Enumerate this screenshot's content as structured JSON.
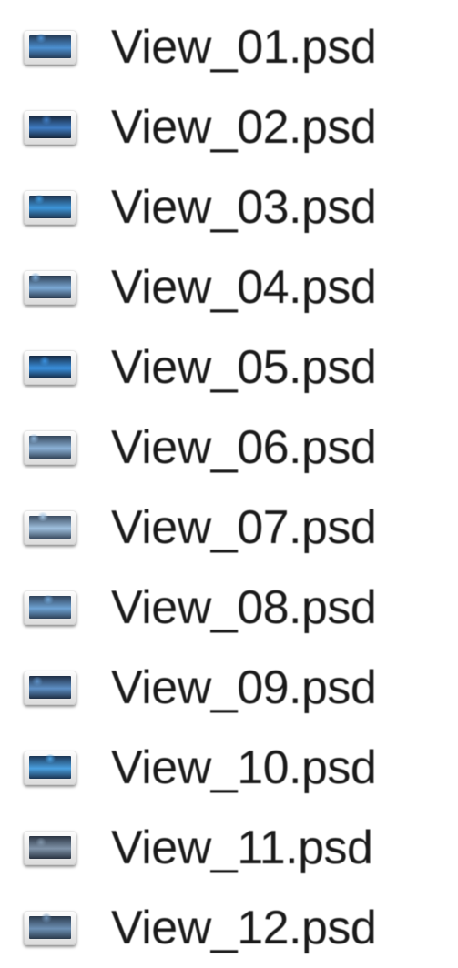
{
  "files": [
    {
      "name": "View_01.psd",
      "icon": "psd-file-icon",
      "thumb_color": "#253c57",
      "accent": "#4c8fd0"
    },
    {
      "name": "View_02.psd",
      "icon": "psd-file-icon",
      "thumb_color": "#15253a",
      "accent": "#3f7cc2"
    },
    {
      "name": "View_03.psd",
      "icon": "psd-file-icon",
      "thumb_color": "#1e3550",
      "accent": "#3d95d8"
    },
    {
      "name": "View_04.psd",
      "icon": "psd-file-icon",
      "thumb_color": "#2b3c50",
      "accent": "#7aa8d4"
    },
    {
      "name": "View_05.psd",
      "icon": "psd-file-icon",
      "thumb_color": "#162a44",
      "accent": "#3a90dd"
    },
    {
      "name": "View_06.psd",
      "icon": "psd-file-icon",
      "thumb_color": "#34465a",
      "accent": "#8bb1d6"
    },
    {
      "name": "View_07.psd",
      "icon": "psd-file-icon",
      "thumb_color": "#3d4e63",
      "accent": "#9fc0de"
    },
    {
      "name": "View_08.psd",
      "icon": "psd-file-icon",
      "thumb_color": "#30435a",
      "accent": "#6ea3d4"
    },
    {
      "name": "View_09.psd",
      "icon": "psd-file-icon",
      "thumb_color": "#1f2f45",
      "accent": "#5d8fc4"
    },
    {
      "name": "View_10.psd",
      "icon": "psd-file-icon",
      "thumb_color": "#1b3554",
      "accent": "#4aa0e0"
    },
    {
      "name": "View_11.psd",
      "icon": "psd-file-icon",
      "thumb_color": "#2a3442",
      "accent": "#7f93a8"
    },
    {
      "name": "View_12.psd",
      "icon": "psd-file-icon",
      "thumb_color": "#2b3a4c",
      "accent": "#6c8fb3"
    }
  ]
}
